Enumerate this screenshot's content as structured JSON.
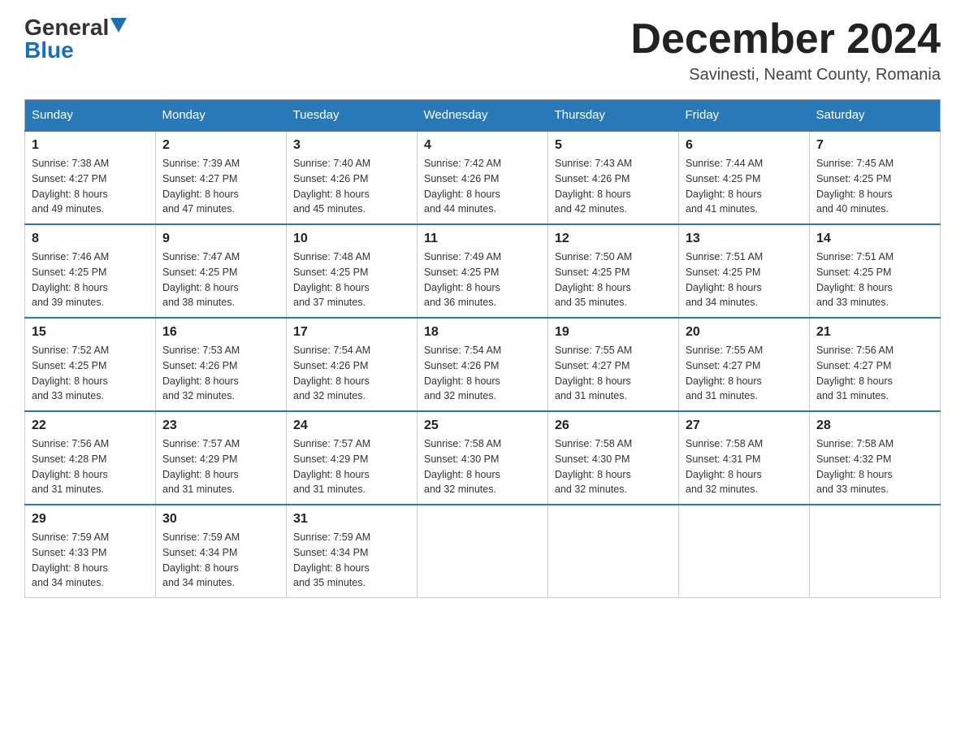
{
  "logo": {
    "general": "General",
    "blue": "Blue"
  },
  "header": {
    "month": "December 2024",
    "location": "Savinesti, Neamt County, Romania"
  },
  "days_of_week": [
    "Sunday",
    "Monday",
    "Tuesday",
    "Wednesday",
    "Thursday",
    "Friday",
    "Saturday"
  ],
  "weeks": [
    [
      {
        "day": "1",
        "sunrise": "7:38 AM",
        "sunset": "4:27 PM",
        "daylight": "8 hours and 49 minutes."
      },
      {
        "day": "2",
        "sunrise": "7:39 AM",
        "sunset": "4:27 PM",
        "daylight": "8 hours and 47 minutes."
      },
      {
        "day": "3",
        "sunrise": "7:40 AM",
        "sunset": "4:26 PM",
        "daylight": "8 hours and 45 minutes."
      },
      {
        "day": "4",
        "sunrise": "7:42 AM",
        "sunset": "4:26 PM",
        "daylight": "8 hours and 44 minutes."
      },
      {
        "day": "5",
        "sunrise": "7:43 AM",
        "sunset": "4:26 PM",
        "daylight": "8 hours and 42 minutes."
      },
      {
        "day": "6",
        "sunrise": "7:44 AM",
        "sunset": "4:25 PM",
        "daylight": "8 hours and 41 minutes."
      },
      {
        "day": "7",
        "sunrise": "7:45 AM",
        "sunset": "4:25 PM",
        "daylight": "8 hours and 40 minutes."
      }
    ],
    [
      {
        "day": "8",
        "sunrise": "7:46 AM",
        "sunset": "4:25 PM",
        "daylight": "8 hours and 39 minutes."
      },
      {
        "day": "9",
        "sunrise": "7:47 AM",
        "sunset": "4:25 PM",
        "daylight": "8 hours and 38 minutes."
      },
      {
        "day": "10",
        "sunrise": "7:48 AM",
        "sunset": "4:25 PM",
        "daylight": "8 hours and 37 minutes."
      },
      {
        "day": "11",
        "sunrise": "7:49 AM",
        "sunset": "4:25 PM",
        "daylight": "8 hours and 36 minutes."
      },
      {
        "day": "12",
        "sunrise": "7:50 AM",
        "sunset": "4:25 PM",
        "daylight": "8 hours and 35 minutes."
      },
      {
        "day": "13",
        "sunrise": "7:51 AM",
        "sunset": "4:25 PM",
        "daylight": "8 hours and 34 minutes."
      },
      {
        "day": "14",
        "sunrise": "7:51 AM",
        "sunset": "4:25 PM",
        "daylight": "8 hours and 33 minutes."
      }
    ],
    [
      {
        "day": "15",
        "sunrise": "7:52 AM",
        "sunset": "4:25 PM",
        "daylight": "8 hours and 33 minutes."
      },
      {
        "day": "16",
        "sunrise": "7:53 AM",
        "sunset": "4:26 PM",
        "daylight": "8 hours and 32 minutes."
      },
      {
        "day": "17",
        "sunrise": "7:54 AM",
        "sunset": "4:26 PM",
        "daylight": "8 hours and 32 minutes."
      },
      {
        "day": "18",
        "sunrise": "7:54 AM",
        "sunset": "4:26 PM",
        "daylight": "8 hours and 32 minutes."
      },
      {
        "day": "19",
        "sunrise": "7:55 AM",
        "sunset": "4:27 PM",
        "daylight": "8 hours and 31 minutes."
      },
      {
        "day": "20",
        "sunrise": "7:55 AM",
        "sunset": "4:27 PM",
        "daylight": "8 hours and 31 minutes."
      },
      {
        "day": "21",
        "sunrise": "7:56 AM",
        "sunset": "4:27 PM",
        "daylight": "8 hours and 31 minutes."
      }
    ],
    [
      {
        "day": "22",
        "sunrise": "7:56 AM",
        "sunset": "4:28 PM",
        "daylight": "8 hours and 31 minutes."
      },
      {
        "day": "23",
        "sunrise": "7:57 AM",
        "sunset": "4:29 PM",
        "daylight": "8 hours and 31 minutes."
      },
      {
        "day": "24",
        "sunrise": "7:57 AM",
        "sunset": "4:29 PM",
        "daylight": "8 hours and 31 minutes."
      },
      {
        "day": "25",
        "sunrise": "7:58 AM",
        "sunset": "4:30 PM",
        "daylight": "8 hours and 32 minutes."
      },
      {
        "day": "26",
        "sunrise": "7:58 AM",
        "sunset": "4:30 PM",
        "daylight": "8 hours and 32 minutes."
      },
      {
        "day": "27",
        "sunrise": "7:58 AM",
        "sunset": "4:31 PM",
        "daylight": "8 hours and 32 minutes."
      },
      {
        "day": "28",
        "sunrise": "7:58 AM",
        "sunset": "4:32 PM",
        "daylight": "8 hours and 33 minutes."
      }
    ],
    [
      {
        "day": "29",
        "sunrise": "7:59 AM",
        "sunset": "4:33 PM",
        "daylight": "8 hours and 34 minutes."
      },
      {
        "day": "30",
        "sunrise": "7:59 AM",
        "sunset": "4:34 PM",
        "daylight": "8 hours and 34 minutes."
      },
      {
        "day": "31",
        "sunrise": "7:59 AM",
        "sunset": "4:34 PM",
        "daylight": "8 hours and 35 minutes."
      },
      null,
      null,
      null,
      null
    ]
  ],
  "labels": {
    "sunrise": "Sunrise: ",
    "sunset": "Sunset: ",
    "daylight": "Daylight: "
  }
}
